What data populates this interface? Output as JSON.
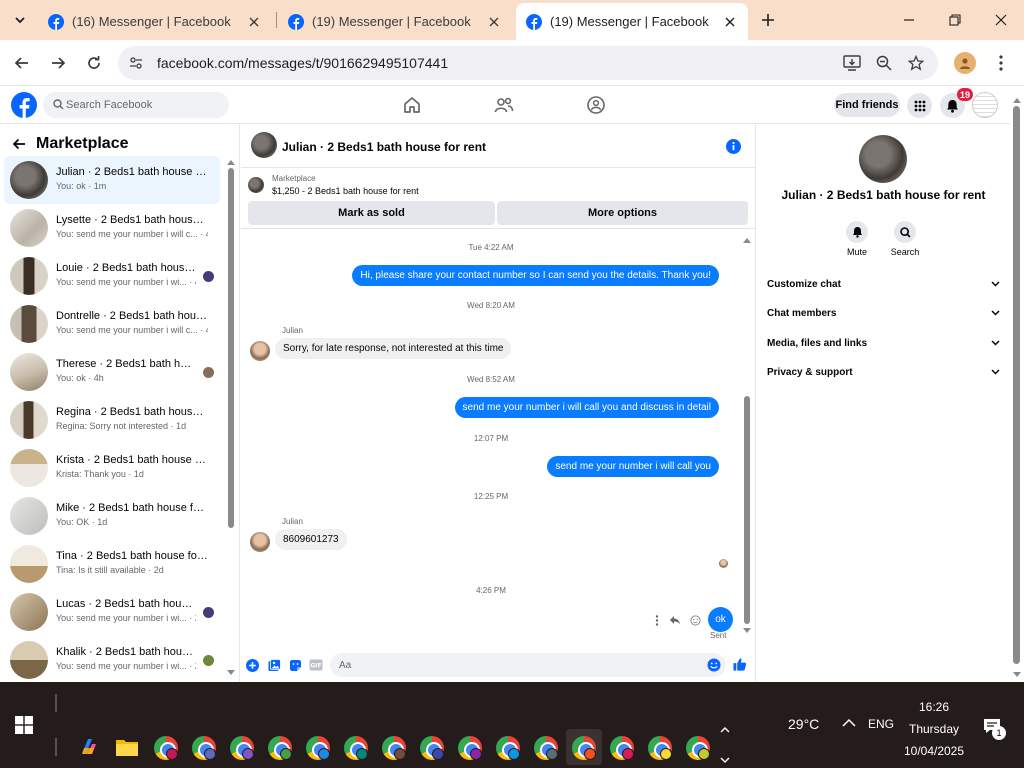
{
  "browser": {
    "tabs": [
      {
        "title": "(16) Messenger | Facebook",
        "active": false
      },
      {
        "title": "(19) Messenger | Facebook",
        "active": false
      },
      {
        "title": "(19) Messenger | Facebook",
        "active": true
      }
    ],
    "url": "facebook.com/messages/t/9016629495107441"
  },
  "fb_header": {
    "search_placeholder": "Search Facebook",
    "find_friends": "Find friends",
    "notification_count": "19"
  },
  "sidebar": {
    "title": "Marketplace",
    "chats": [
      {
        "name": "Julian · 2 Beds1 bath house for rent",
        "preview": "You: ok · 1m",
        "selected": true
      },
      {
        "name": "Lysette · 2 Beds1 bath house for rent",
        "preview": "You: send me your number i will c... · 4h"
      },
      {
        "name": "Louie · 2 Beds1 bath house for rent",
        "preview": "You: send me your number i wi... · 4h"
      },
      {
        "name": "Dontrelle · 2 Beds1 bath house for rent",
        "preview": "You: send me your number i will c... · 4h"
      },
      {
        "name": "Therese · 2 Beds1 bath house for rent",
        "preview": "You: ok · 4h"
      },
      {
        "name": "Regina · 2 Beds1 bath house for rent",
        "preview": "Regina: Sorry not interested · 1d"
      },
      {
        "name": "Krista · 2 Beds1 bath house for rent",
        "preview": "Krista: Thank you · 1d"
      },
      {
        "name": "Mike · 2 Beds1 bath house for rent",
        "preview": "You: OK · 1d"
      },
      {
        "name": "Tina · 2 Beds1 bath house for rent",
        "preview": "Tina: Is it still available · 2d"
      },
      {
        "name": "Lucas · 2 Beds1 bath house for rent",
        "preview": "You: send me your number i wi... · 2d"
      },
      {
        "name": "Khalik · 2 Beds1 bath house for rent",
        "preview": "You: send me your number i wi... · 2d"
      }
    ]
  },
  "conversation": {
    "title": "Julian · 2 Beds1 bath house for rent",
    "marketplace_label": "Marketplace",
    "listing": "$1,250 - 2 Beds1 bath house for rent",
    "mark_sold": "Mark as sold",
    "more_options": "More options",
    "timestamps": [
      "Tue 4:22 AM",
      "Wed 8:20 AM",
      "Wed 8:52 AM",
      "12:07 PM",
      "12:25 PM",
      "4:26 PM"
    ],
    "messages": [
      "Hi, please share your contact number so I can send you the details. Thank you!",
      "Sorry,  for late response,  not interested at this time",
      "send me your number i will call you and discuss in detail",
      "send me your number i will call you",
      "8609601273",
      "ok"
    ],
    "sender_name": "Julian",
    "sent_label": "Sent",
    "composer_placeholder": "Aa"
  },
  "info_panel": {
    "title": "Julian · 2 Beds1 bath house for rent",
    "mute": "Mute",
    "search": "Search",
    "sections": [
      "Customize chat",
      "Chat members",
      "Media, files and links",
      "Privacy & support"
    ]
  },
  "taskbar": {
    "temperature": "29°C",
    "language": "ENG",
    "time": "16:26",
    "day": "Thursday",
    "date": "10/04/2025",
    "notifications": "1"
  },
  "colors": {
    "messenger_blue": "#0a7cff",
    "facebook_blue": "#0866ff",
    "tab_strip": "#f9dec9",
    "taskbar": "#241c1a"
  }
}
